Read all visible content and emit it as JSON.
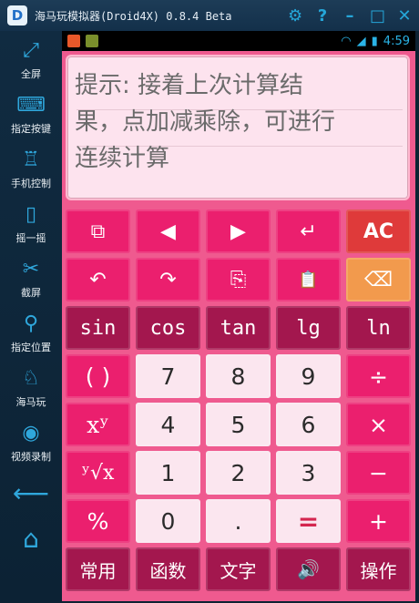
{
  "window": {
    "title": "海马玩模拟器(Droid4X) 0.8.4 Beta",
    "logo_text": "D",
    "icons": [
      "gear-icon",
      "help-icon",
      "minimize-icon",
      "maximize-icon",
      "close-icon"
    ]
  },
  "sidebar": {
    "items": [
      {
        "label": "全屏",
        "icon": "fullscreen-icon",
        "glyph": "⤢"
      },
      {
        "label": "指定按键",
        "icon": "keyboard-icon",
        "glyph": "⌨"
      },
      {
        "label": "手机控制",
        "icon": "joystick-icon",
        "glyph": "♖"
      },
      {
        "label": "摇一摇",
        "icon": "shake-phone-icon",
        "glyph": "▯"
      },
      {
        "label": "截屏",
        "icon": "scissors-icon",
        "glyph": "✂"
      },
      {
        "label": "指定位置",
        "icon": "location-pin-icon",
        "glyph": "⚲"
      },
      {
        "label": "海马玩",
        "icon": "seahorse-icon",
        "glyph": "♘"
      },
      {
        "label": "视频录制",
        "icon": "webcam-icon",
        "glyph": "◉"
      }
    ],
    "back_icon": "back-arrow-icon",
    "home_icon": "home-icon"
  },
  "statusbar": {
    "time": "4:59",
    "icons": [
      "app-icon-1",
      "app-icon-2",
      "wifi-icon",
      "signal-icon",
      "battery-icon"
    ]
  },
  "display": {
    "lines": [
      "提示: 接着上次计算结",
      "果，点加减乘除，可进行",
      "连续计算"
    ]
  },
  "keys": {
    "row1": [
      "⧉",
      "◀",
      "▶",
      "↵",
      "AC"
    ],
    "row2": [
      "↶",
      "↷",
      "⎘",
      "📋",
      "⌫"
    ],
    "row3": [
      "sin",
      "cos",
      "tan",
      "lg",
      "ln"
    ],
    "row4": [
      "( )",
      "7",
      "8",
      "9",
      "÷"
    ],
    "row5": [
      "xʸ",
      "4",
      "5",
      "6",
      "×"
    ],
    "row6": [
      "ʸ√x",
      "1",
      "2",
      "3",
      "−"
    ],
    "row7": [
      "%",
      "0",
      ".",
      "=",
      "+"
    ],
    "row8": [
      "常用",
      "函数",
      "文字",
      "🔊",
      "操作"
    ]
  },
  "colors": {
    "accent_pink": "#eb1f6e",
    "dark_pink": "#a3174e",
    "light_key": "#fbe6ef",
    "clear_red": "#df3a3a",
    "backspace_orange": "#f29a4d",
    "background": "#ef5a8f"
  }
}
